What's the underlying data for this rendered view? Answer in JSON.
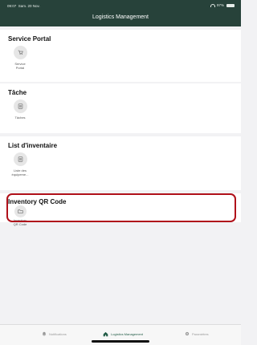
{
  "status_bar": {
    "time": "09:07",
    "date": "Sam. 20 Nov.",
    "battery": "97%"
  },
  "header": {
    "title": "Logistics Management"
  },
  "sections": [
    {
      "title": "Service Portal",
      "tile_label": "Service\nPortal",
      "icon": "cart-icon"
    },
    {
      "title": "Tâche",
      "tile_label": "Tâches",
      "icon": "list-icon"
    },
    {
      "title": "List d'inventaire",
      "tile_label": "Liste des\néquipeme...",
      "icon": "list-icon"
    },
    {
      "title": "Inventory QR Code",
      "tile_label": "Inventory\nQR Code",
      "icon": "folder-icon"
    }
  ],
  "tabbar": {
    "tabs": [
      {
        "label": "Notifications",
        "icon": "bell-icon",
        "active": false
      },
      {
        "label": "Logistics Management",
        "icon": "home-icon",
        "active": true
      },
      {
        "label": "Paramètres",
        "icon": "gear-icon",
        "active": false
      }
    ]
  },
  "colors": {
    "header_bg": "#27423a",
    "active_tab": "#1f5a44",
    "inactive_tab": "#999999",
    "highlight": "#b0101a"
  }
}
